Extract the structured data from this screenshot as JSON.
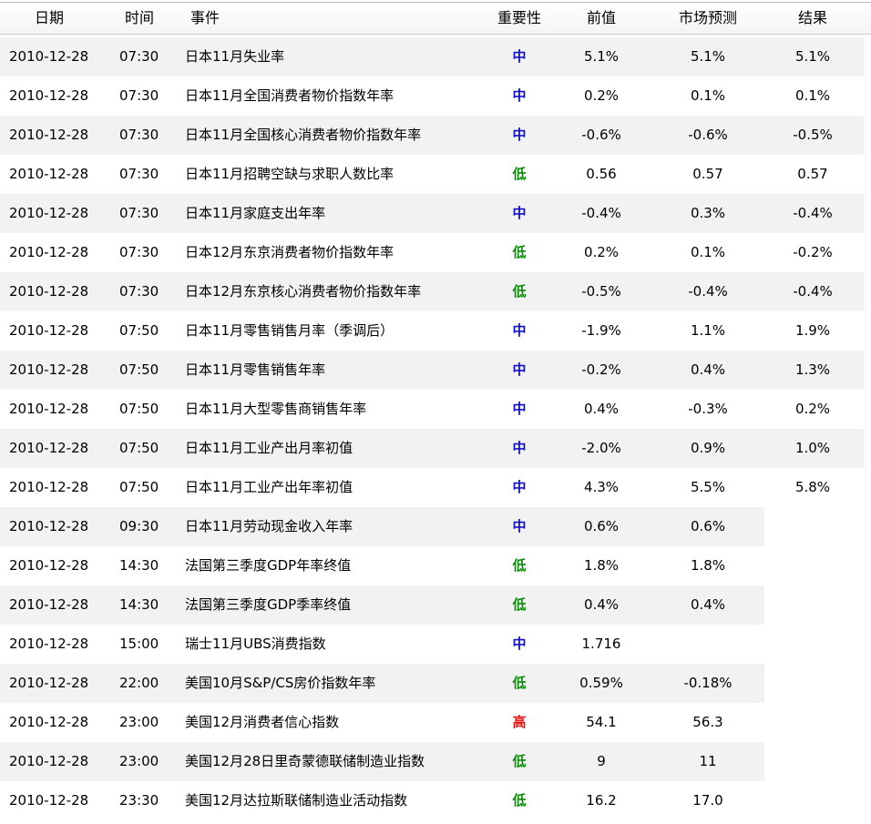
{
  "header": {
    "date": "日期",
    "time": "时间",
    "event": "事件",
    "importance": "重要性",
    "previous": "前值",
    "forecast": "市场预测",
    "actual": "结果"
  },
  "colors": {
    "importance_mid": "#1010c8",
    "importance_low": "#0c8a0c",
    "importance_high": "#e01010",
    "row_stripe": "#f2f2f2"
  },
  "rows": [
    {
      "date": "2010-12-28",
      "time": "07:30",
      "event": "日本11月失业率",
      "importance": "中",
      "previous": "5.1%",
      "forecast": "5.1%",
      "actual": "5.1%"
    },
    {
      "date": "2010-12-28",
      "time": "07:30",
      "event": "日本11月全国消费者物价指数年率",
      "importance": "中",
      "previous": "0.2%",
      "forecast": "0.1%",
      "actual": "0.1%"
    },
    {
      "date": "2010-12-28",
      "time": "07:30",
      "event": "日本11月全国核心消费者物价指数年率",
      "importance": "中",
      "previous": "-0.6%",
      "forecast": "-0.6%",
      "actual": "-0.5%"
    },
    {
      "date": "2010-12-28",
      "time": "07:30",
      "event": "日本11月招聘空缺与求职人数比率",
      "importance": "低",
      "previous": "0.56",
      "forecast": "0.57",
      "actual": "0.57"
    },
    {
      "date": "2010-12-28",
      "time": "07:30",
      "event": "日本11月家庭支出年率",
      "importance": "中",
      "previous": "-0.4%",
      "forecast": "0.3%",
      "actual": "-0.4%"
    },
    {
      "date": "2010-12-28",
      "time": "07:30",
      "event": "日本12月东京消费者物价指数年率",
      "importance": "低",
      "previous": "0.2%",
      "forecast": "0.1%",
      "actual": "-0.2%"
    },
    {
      "date": "2010-12-28",
      "time": "07:30",
      "event": "日本12月东京核心消费者物价指数年率",
      "importance": "低",
      "previous": "-0.5%",
      "forecast": "-0.4%",
      "actual": "-0.4%"
    },
    {
      "date": "2010-12-28",
      "time": "07:50",
      "event": "日本11月零售销售月率（季调后）",
      "importance": "中",
      "previous": "-1.9%",
      "forecast": "1.1%",
      "actual": "1.9%"
    },
    {
      "date": "2010-12-28",
      "time": "07:50",
      "event": "日本11月零售销售年率",
      "importance": "中",
      "previous": "-0.2%",
      "forecast": "0.4%",
      "actual": "1.3%"
    },
    {
      "date": "2010-12-28",
      "time": "07:50",
      "event": "日本11月大型零售商销售年率",
      "importance": "中",
      "previous": "0.4%",
      "forecast": "-0.3%",
      "actual": "0.2%"
    },
    {
      "date": "2010-12-28",
      "time": "07:50",
      "event": "日本11月工业产出月率初值",
      "importance": "中",
      "previous": "-2.0%",
      "forecast": "0.9%",
      "actual": "1.0%"
    },
    {
      "date": "2010-12-28",
      "time": "07:50",
      "event": "日本11月工业产出年率初值",
      "importance": "中",
      "previous": "4.3%",
      "forecast": "5.5%",
      "actual": "5.8%"
    },
    {
      "date": "2010-12-28",
      "time": "09:30",
      "event": "日本11月劳动现金收入年率",
      "importance": "中",
      "previous": "0.6%",
      "forecast": "0.6%",
      "actual": ""
    },
    {
      "date": "2010-12-28",
      "time": "14:30",
      "event": "法国第三季度GDP年率终值",
      "importance": "低",
      "previous": "1.8%",
      "forecast": "1.8%",
      "actual": ""
    },
    {
      "date": "2010-12-28",
      "time": "14:30",
      "event": "法国第三季度GDP季率终值",
      "importance": "低",
      "previous": "0.4%",
      "forecast": "0.4%",
      "actual": ""
    },
    {
      "date": "2010-12-28",
      "time": "15:00",
      "event": "瑞士11月UBS消费指数",
      "importance": "中",
      "previous": "1.716",
      "forecast": "",
      "actual": ""
    },
    {
      "date": "2010-12-28",
      "time": "22:00",
      "event": "美国10月S&P/CS房价指数年率",
      "importance": "低",
      "previous": "0.59%",
      "forecast": "-0.18%",
      "actual": ""
    },
    {
      "date": "2010-12-28",
      "time": "23:00",
      "event": "美国12月消费者信心指数",
      "importance": "高",
      "previous": "54.1",
      "forecast": "56.3",
      "actual": ""
    },
    {
      "date": "2010-12-28",
      "time": "23:00",
      "event": "美国12月28日里奇蒙德联储制造业指数",
      "importance": "低",
      "previous": "9",
      "forecast": "11",
      "actual": ""
    },
    {
      "date": "2010-12-28",
      "time": "23:30",
      "event": "美国12月达拉斯联储制造业活动指数",
      "importance": "低",
      "previous": "16.2",
      "forecast": "17.0",
      "actual": ""
    }
  ]
}
